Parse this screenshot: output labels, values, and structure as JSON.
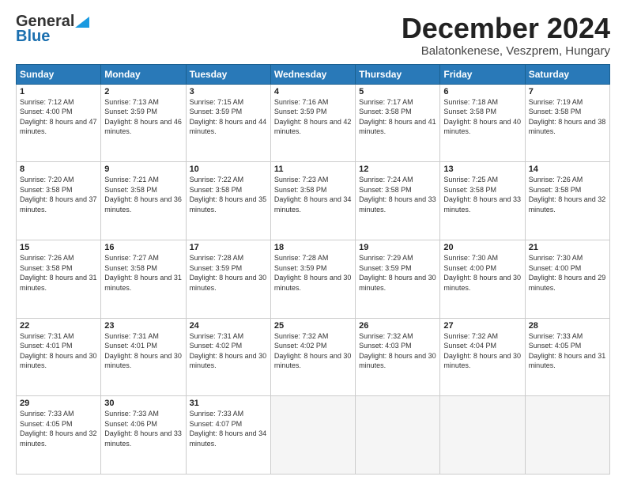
{
  "logo": {
    "line1": "General",
    "line2": "Blue"
  },
  "header": {
    "month": "December 2024",
    "location": "Balatonkenese, Veszprem, Hungary"
  },
  "weekdays": [
    "Sunday",
    "Monday",
    "Tuesday",
    "Wednesday",
    "Thursday",
    "Friday",
    "Saturday"
  ],
  "weeks": [
    [
      {
        "day": 1,
        "sunrise": "7:12 AM",
        "sunset": "4:00 PM",
        "daylight": "8 hours and 47 minutes."
      },
      {
        "day": 2,
        "sunrise": "7:13 AM",
        "sunset": "3:59 PM",
        "daylight": "8 hours and 46 minutes."
      },
      {
        "day": 3,
        "sunrise": "7:15 AM",
        "sunset": "3:59 PM",
        "daylight": "8 hours and 44 minutes."
      },
      {
        "day": 4,
        "sunrise": "7:16 AM",
        "sunset": "3:59 PM",
        "daylight": "8 hours and 42 minutes."
      },
      {
        "day": 5,
        "sunrise": "7:17 AM",
        "sunset": "3:58 PM",
        "daylight": "8 hours and 41 minutes."
      },
      {
        "day": 6,
        "sunrise": "7:18 AM",
        "sunset": "3:58 PM",
        "daylight": "8 hours and 40 minutes."
      },
      {
        "day": 7,
        "sunrise": "7:19 AM",
        "sunset": "3:58 PM",
        "daylight": "8 hours and 38 minutes."
      }
    ],
    [
      {
        "day": 8,
        "sunrise": "7:20 AM",
        "sunset": "3:58 PM",
        "daylight": "8 hours and 37 minutes."
      },
      {
        "day": 9,
        "sunrise": "7:21 AM",
        "sunset": "3:58 PM",
        "daylight": "8 hours and 36 minutes."
      },
      {
        "day": 10,
        "sunrise": "7:22 AM",
        "sunset": "3:58 PM",
        "daylight": "8 hours and 35 minutes."
      },
      {
        "day": 11,
        "sunrise": "7:23 AM",
        "sunset": "3:58 PM",
        "daylight": "8 hours and 34 minutes."
      },
      {
        "day": 12,
        "sunrise": "7:24 AM",
        "sunset": "3:58 PM",
        "daylight": "8 hours and 33 minutes."
      },
      {
        "day": 13,
        "sunrise": "7:25 AM",
        "sunset": "3:58 PM",
        "daylight": "8 hours and 33 minutes."
      },
      {
        "day": 14,
        "sunrise": "7:26 AM",
        "sunset": "3:58 PM",
        "daylight": "8 hours and 32 minutes."
      }
    ],
    [
      {
        "day": 15,
        "sunrise": "7:26 AM",
        "sunset": "3:58 PM",
        "daylight": "8 hours and 31 minutes."
      },
      {
        "day": 16,
        "sunrise": "7:27 AM",
        "sunset": "3:58 PM",
        "daylight": "8 hours and 31 minutes."
      },
      {
        "day": 17,
        "sunrise": "7:28 AM",
        "sunset": "3:59 PM",
        "daylight": "8 hours and 30 minutes."
      },
      {
        "day": 18,
        "sunrise": "7:28 AM",
        "sunset": "3:59 PM",
        "daylight": "8 hours and 30 minutes."
      },
      {
        "day": 19,
        "sunrise": "7:29 AM",
        "sunset": "3:59 PM",
        "daylight": "8 hours and 30 minutes."
      },
      {
        "day": 20,
        "sunrise": "7:30 AM",
        "sunset": "4:00 PM",
        "daylight": "8 hours and 30 minutes."
      },
      {
        "day": 21,
        "sunrise": "7:30 AM",
        "sunset": "4:00 PM",
        "daylight": "8 hours and 29 minutes."
      }
    ],
    [
      {
        "day": 22,
        "sunrise": "7:31 AM",
        "sunset": "4:01 PM",
        "daylight": "8 hours and 30 minutes."
      },
      {
        "day": 23,
        "sunrise": "7:31 AM",
        "sunset": "4:01 PM",
        "daylight": "8 hours and 30 minutes."
      },
      {
        "day": 24,
        "sunrise": "7:31 AM",
        "sunset": "4:02 PM",
        "daylight": "8 hours and 30 minutes."
      },
      {
        "day": 25,
        "sunrise": "7:32 AM",
        "sunset": "4:02 PM",
        "daylight": "8 hours and 30 minutes."
      },
      {
        "day": 26,
        "sunrise": "7:32 AM",
        "sunset": "4:03 PM",
        "daylight": "8 hours and 30 minutes."
      },
      {
        "day": 27,
        "sunrise": "7:32 AM",
        "sunset": "4:04 PM",
        "daylight": "8 hours and 30 minutes."
      },
      {
        "day": 28,
        "sunrise": "7:33 AM",
        "sunset": "4:05 PM",
        "daylight": "8 hours and 31 minutes."
      }
    ],
    [
      {
        "day": 29,
        "sunrise": "7:33 AM",
        "sunset": "4:05 PM",
        "daylight": "8 hours and 32 minutes."
      },
      {
        "day": 30,
        "sunrise": "7:33 AM",
        "sunset": "4:06 PM",
        "daylight": "8 hours and 33 minutes."
      },
      {
        "day": 31,
        "sunrise": "7:33 AM",
        "sunset": "4:07 PM",
        "daylight": "8 hours and 34 minutes."
      },
      null,
      null,
      null,
      null
    ]
  ]
}
